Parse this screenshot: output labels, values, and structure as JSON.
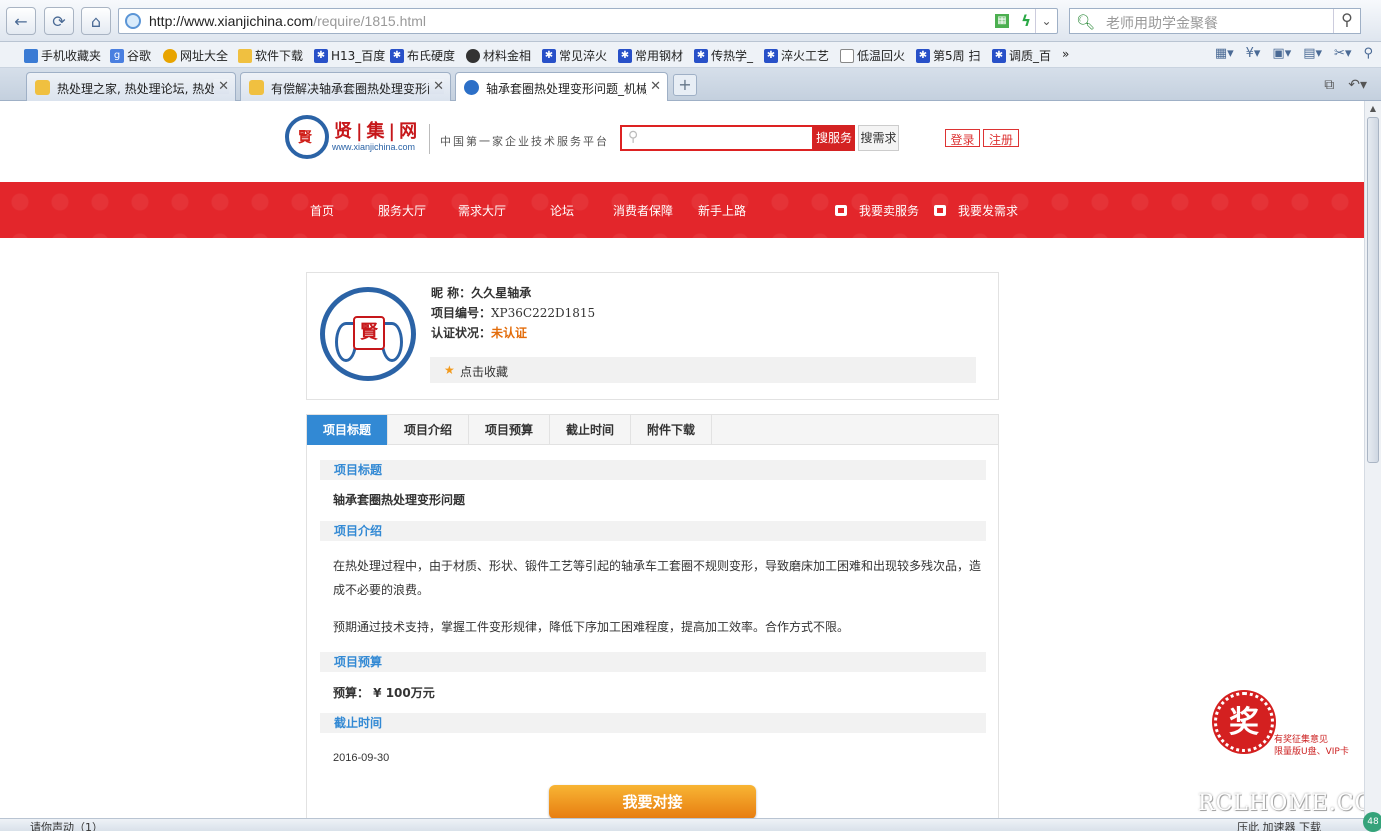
{
  "browser": {
    "url_host": "http://www.xianjichina.com",
    "url_path": "/require/1815.html",
    "search_placeholder": "老师用助学金聚餐",
    "bookmarks": [
      "手机收藏夹",
      "谷歌",
      "网址大全",
      "软件下载",
      "H13_百度",
      "布氏硬度",
      "材料金相",
      "常见淬火",
      "常用钢材",
      "传热学_",
      "淬火工艺",
      "低温回火",
      "第5周 扫",
      "调质_百",
      "»"
    ],
    "tabs": [
      {
        "title": "热处理之家, 热处理论坛, 热处理",
        "active": false
      },
      {
        "title": "有偿解决轴承套圈热处理变形问",
        "active": false
      },
      {
        "title": "轴承套圈热处理变形问题_机械",
        "active": true
      }
    ],
    "new_tab": "+",
    "status_text": "请你声动（1）",
    "status_right": "压此    加速器    下载",
    "status_bubble": "48"
  },
  "site": {
    "logo_name": "贤|集|网",
    "logo_url": "www.xianjichina.com",
    "slogan": "中国第一家企业技术服务平台",
    "search_service_label": "搜服务",
    "search_demand_label": "搜需求",
    "login_label": "登录",
    "register_label": "注册",
    "nav": [
      "首页",
      "服务大厅",
      "需求大厅",
      "论坛",
      "消费者保障",
      "新手上路"
    ],
    "sell_service": "我要卖服务",
    "post_demand": "我要发需求"
  },
  "profile": {
    "nickname_label": "昵  称：",
    "nickname": "久久星轴承",
    "project_no_label": "项目编号：",
    "project_no": "XP36C222D1815",
    "cert_label": "认证状况：",
    "cert_status": "未认证",
    "favorite_label": "点击收藏",
    "avatar_char": "賢"
  },
  "detail": {
    "tabs": [
      "项目标题",
      "项目介绍",
      "项目预算",
      "截止时间",
      "附件下载"
    ],
    "title_heading": "项目标题",
    "title": "轴承套圈热处理变形问题",
    "intro_heading": "项目介绍",
    "intro_p1": "在热处理过程中，由于材质、形状、锻件工艺等引起的轴承车工套圈不规则变形，导致磨床加工困难和出现较多残次品，造成不必要的浪费。",
    "intro_p2": "预期通过技术支持，掌握工件变形规律，降低下序加工困难程度，提高加工效率。合作方式不限。",
    "budget_heading": "项目预算",
    "budget": "预算：  ¥ 100万元",
    "deadline_heading": "截止时间",
    "deadline": "2016-09-30",
    "connect_label": "我要对接"
  },
  "badge": {
    "seal": "奖",
    "line1": "有奖征集意见",
    "line2": "限量版U盘、VIP卡"
  },
  "watermark": "RCLHOME.COM"
}
